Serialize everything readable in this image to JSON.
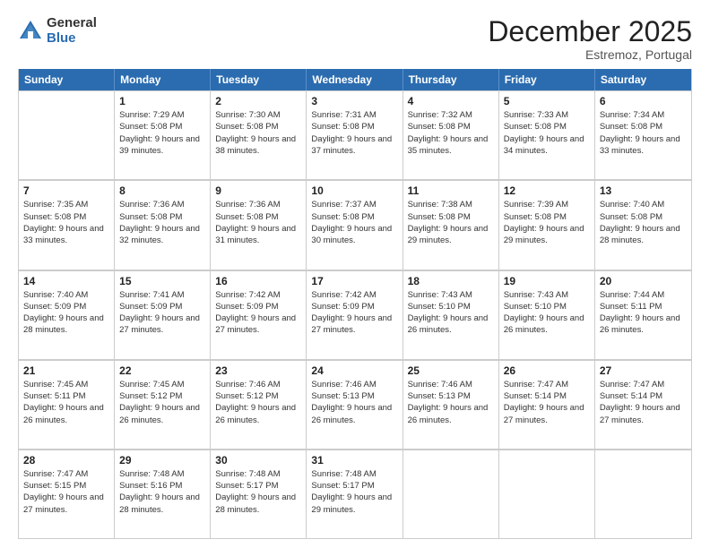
{
  "header": {
    "logo_general": "General",
    "logo_blue": "Blue",
    "month_title": "December 2025",
    "subtitle": "Estremoz, Portugal"
  },
  "weekdays": [
    "Sunday",
    "Monday",
    "Tuesday",
    "Wednesday",
    "Thursday",
    "Friday",
    "Saturday"
  ],
  "rows": [
    [
      {
        "day": "",
        "sunrise": "",
        "sunset": "",
        "daylight": ""
      },
      {
        "day": "1",
        "sunrise": "Sunrise: 7:29 AM",
        "sunset": "Sunset: 5:08 PM",
        "daylight": "Daylight: 9 hours and 39 minutes."
      },
      {
        "day": "2",
        "sunrise": "Sunrise: 7:30 AM",
        "sunset": "Sunset: 5:08 PM",
        "daylight": "Daylight: 9 hours and 38 minutes."
      },
      {
        "day": "3",
        "sunrise": "Sunrise: 7:31 AM",
        "sunset": "Sunset: 5:08 PM",
        "daylight": "Daylight: 9 hours and 37 minutes."
      },
      {
        "day": "4",
        "sunrise": "Sunrise: 7:32 AM",
        "sunset": "Sunset: 5:08 PM",
        "daylight": "Daylight: 9 hours and 35 minutes."
      },
      {
        "day": "5",
        "sunrise": "Sunrise: 7:33 AM",
        "sunset": "Sunset: 5:08 PM",
        "daylight": "Daylight: 9 hours and 34 minutes."
      },
      {
        "day": "6",
        "sunrise": "Sunrise: 7:34 AM",
        "sunset": "Sunset: 5:08 PM",
        "daylight": "Daylight: 9 hours and 33 minutes."
      }
    ],
    [
      {
        "day": "7",
        "sunrise": "Sunrise: 7:35 AM",
        "sunset": "Sunset: 5:08 PM",
        "daylight": "Daylight: 9 hours and 33 minutes."
      },
      {
        "day": "8",
        "sunrise": "Sunrise: 7:36 AM",
        "sunset": "Sunset: 5:08 PM",
        "daylight": "Daylight: 9 hours and 32 minutes."
      },
      {
        "day": "9",
        "sunrise": "Sunrise: 7:36 AM",
        "sunset": "Sunset: 5:08 PM",
        "daylight": "Daylight: 9 hours and 31 minutes."
      },
      {
        "day": "10",
        "sunrise": "Sunrise: 7:37 AM",
        "sunset": "Sunset: 5:08 PM",
        "daylight": "Daylight: 9 hours and 30 minutes."
      },
      {
        "day": "11",
        "sunrise": "Sunrise: 7:38 AM",
        "sunset": "Sunset: 5:08 PM",
        "daylight": "Daylight: 9 hours and 29 minutes."
      },
      {
        "day": "12",
        "sunrise": "Sunrise: 7:39 AM",
        "sunset": "Sunset: 5:08 PM",
        "daylight": "Daylight: 9 hours and 29 minutes."
      },
      {
        "day": "13",
        "sunrise": "Sunrise: 7:40 AM",
        "sunset": "Sunset: 5:08 PM",
        "daylight": "Daylight: 9 hours and 28 minutes."
      }
    ],
    [
      {
        "day": "14",
        "sunrise": "Sunrise: 7:40 AM",
        "sunset": "Sunset: 5:09 PM",
        "daylight": "Daylight: 9 hours and 28 minutes."
      },
      {
        "day": "15",
        "sunrise": "Sunrise: 7:41 AM",
        "sunset": "Sunset: 5:09 PM",
        "daylight": "Daylight: 9 hours and 27 minutes."
      },
      {
        "day": "16",
        "sunrise": "Sunrise: 7:42 AM",
        "sunset": "Sunset: 5:09 PM",
        "daylight": "Daylight: 9 hours and 27 minutes."
      },
      {
        "day": "17",
        "sunrise": "Sunrise: 7:42 AM",
        "sunset": "Sunset: 5:09 PM",
        "daylight": "Daylight: 9 hours and 27 minutes."
      },
      {
        "day": "18",
        "sunrise": "Sunrise: 7:43 AM",
        "sunset": "Sunset: 5:10 PM",
        "daylight": "Daylight: 9 hours and 26 minutes."
      },
      {
        "day": "19",
        "sunrise": "Sunrise: 7:43 AM",
        "sunset": "Sunset: 5:10 PM",
        "daylight": "Daylight: 9 hours and 26 minutes."
      },
      {
        "day": "20",
        "sunrise": "Sunrise: 7:44 AM",
        "sunset": "Sunset: 5:11 PM",
        "daylight": "Daylight: 9 hours and 26 minutes."
      }
    ],
    [
      {
        "day": "21",
        "sunrise": "Sunrise: 7:45 AM",
        "sunset": "Sunset: 5:11 PM",
        "daylight": "Daylight: 9 hours and 26 minutes."
      },
      {
        "day": "22",
        "sunrise": "Sunrise: 7:45 AM",
        "sunset": "Sunset: 5:12 PM",
        "daylight": "Daylight: 9 hours and 26 minutes."
      },
      {
        "day": "23",
        "sunrise": "Sunrise: 7:46 AM",
        "sunset": "Sunset: 5:12 PM",
        "daylight": "Daylight: 9 hours and 26 minutes."
      },
      {
        "day": "24",
        "sunrise": "Sunrise: 7:46 AM",
        "sunset": "Sunset: 5:13 PM",
        "daylight": "Daylight: 9 hours and 26 minutes."
      },
      {
        "day": "25",
        "sunrise": "Sunrise: 7:46 AM",
        "sunset": "Sunset: 5:13 PM",
        "daylight": "Daylight: 9 hours and 26 minutes."
      },
      {
        "day": "26",
        "sunrise": "Sunrise: 7:47 AM",
        "sunset": "Sunset: 5:14 PM",
        "daylight": "Daylight: 9 hours and 27 minutes."
      },
      {
        "day": "27",
        "sunrise": "Sunrise: 7:47 AM",
        "sunset": "Sunset: 5:14 PM",
        "daylight": "Daylight: 9 hours and 27 minutes."
      }
    ],
    [
      {
        "day": "28",
        "sunrise": "Sunrise: 7:47 AM",
        "sunset": "Sunset: 5:15 PM",
        "daylight": "Daylight: 9 hours and 27 minutes."
      },
      {
        "day": "29",
        "sunrise": "Sunrise: 7:48 AM",
        "sunset": "Sunset: 5:16 PM",
        "daylight": "Daylight: 9 hours and 28 minutes."
      },
      {
        "day": "30",
        "sunrise": "Sunrise: 7:48 AM",
        "sunset": "Sunset: 5:17 PM",
        "daylight": "Daylight: 9 hours and 28 minutes."
      },
      {
        "day": "31",
        "sunrise": "Sunrise: 7:48 AM",
        "sunset": "Sunset: 5:17 PM",
        "daylight": "Daylight: 9 hours and 29 minutes."
      },
      {
        "day": "",
        "sunrise": "",
        "sunset": "",
        "daylight": ""
      },
      {
        "day": "",
        "sunrise": "",
        "sunset": "",
        "daylight": ""
      },
      {
        "day": "",
        "sunrise": "",
        "sunset": "",
        "daylight": ""
      }
    ]
  ]
}
